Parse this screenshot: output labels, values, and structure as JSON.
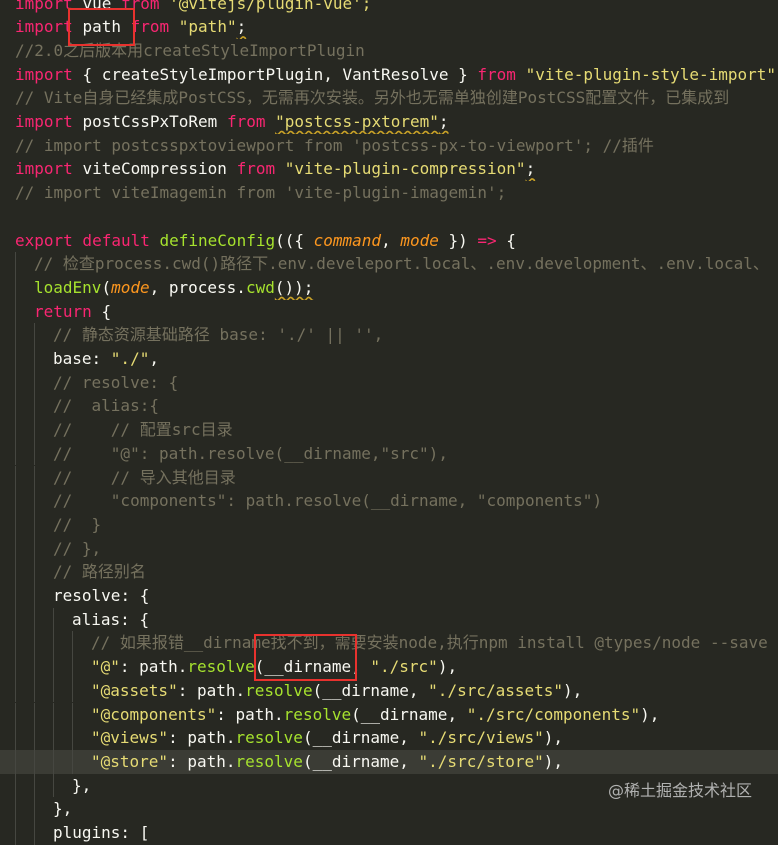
{
  "colors": {
    "background": "#272822",
    "keyword": "#f92672",
    "function": "#a6e22e",
    "string": "#e6db74",
    "comment": "#75715e",
    "param": "#fd971f",
    "text": "#f8f8f2",
    "annotation": "#e8322e"
  },
  "lines": [
    {
      "indent": 0,
      "tokens": [
        {
          "t": "import ",
          "c": "kw"
        },
        {
          "t": "vue ",
          "c": "tx"
        },
        {
          "t": "from ",
          "c": "kw"
        },
        {
          "t": "'@vitejs/plugin-vue';",
          "c": "st"
        }
      ]
    },
    {
      "indent": 0,
      "tokens": [
        {
          "t": "import ",
          "c": "kw"
        },
        {
          "t": "path ",
          "c": "tx"
        },
        {
          "t": "from ",
          "c": "kw"
        },
        {
          "t": "\"path\"",
          "c": "st"
        },
        {
          "t": ";",
          "c": "tx"
        }
      ]
    },
    {
      "indent": 0,
      "tokens": [
        {
          "t": "//2.0之后版本用createStyleImportPlugin",
          "c": "cm"
        }
      ]
    },
    {
      "indent": 0,
      "tokens": [
        {
          "t": "import ",
          "c": "kw"
        },
        {
          "t": "{ createStyleImportPlugin, VantResolve } ",
          "c": "tx"
        },
        {
          "t": "from ",
          "c": "kw"
        },
        {
          "t": "\"vite-plugin-style-import\"",
          "c": "st"
        },
        {
          "t": ";",
          "c": "tx"
        }
      ]
    },
    {
      "indent": 0,
      "tokens": [
        {
          "t": "// Vite自身已经集成PostCSS，无需再次安装。另外也无需单独创建PostCSS配置文件，已集成到",
          "c": "cm"
        }
      ]
    },
    {
      "indent": 0,
      "tokens": [
        {
          "t": "import ",
          "c": "kw"
        },
        {
          "t": "postCssPxToRem ",
          "c": "tx"
        },
        {
          "t": "from ",
          "c": "kw"
        },
        {
          "t": "\"postcss-pxtorem\"",
          "c": "st"
        },
        {
          "t": ";",
          "c": "tx"
        }
      ]
    },
    {
      "indent": 0,
      "tokens": [
        {
          "t": "// import postcsspxtoviewport from 'postcss-px-to-viewport'; //插件",
          "c": "cm"
        }
      ]
    },
    {
      "indent": 0,
      "tokens": [
        {
          "t": "import ",
          "c": "kw"
        },
        {
          "t": "viteCompression ",
          "c": "tx"
        },
        {
          "t": "from ",
          "c": "kw"
        },
        {
          "t": "\"vite-plugin-compression\"",
          "c": "st"
        },
        {
          "t": ";",
          "c": "tx"
        }
      ]
    },
    {
      "indent": 0,
      "tokens": [
        {
          "t": "// import viteImagemin from 'vite-plugin-imagemin';",
          "c": "cm"
        }
      ]
    },
    {
      "indent": 0,
      "tokens": []
    },
    {
      "indent": 0,
      "tokens": [
        {
          "t": "export default ",
          "c": "kw"
        },
        {
          "t": "defineConfig",
          "c": "fn"
        },
        {
          "t": "(({ ",
          "c": "tx"
        },
        {
          "t": "command",
          "c": "pa"
        },
        {
          "t": ", ",
          "c": "tx"
        },
        {
          "t": "mode",
          "c": "pa"
        },
        {
          "t": " }) ",
          "c": "tx"
        },
        {
          "t": "=>",
          "c": "kw"
        },
        {
          "t": " {",
          "c": "tx"
        }
      ]
    },
    {
      "indent": 1,
      "tokens": [
        {
          "t": "// 检查process.cwd()路径下.env.develeport.local、.env.development、.env.local、",
          "c": "cm"
        }
      ]
    },
    {
      "indent": 1,
      "tokens": [
        {
          "t": "loadEnv",
          "c": "fn"
        },
        {
          "t": "(",
          "c": "tx"
        },
        {
          "t": "mode",
          "c": "pa"
        },
        {
          "t": ", process.",
          "c": "tx"
        },
        {
          "t": "cwd",
          "c": "fn"
        },
        {
          "t": "());",
          "c": "tx"
        }
      ]
    },
    {
      "indent": 1,
      "tokens": [
        {
          "t": "return ",
          "c": "kw"
        },
        {
          "t": "{",
          "c": "tx"
        }
      ]
    },
    {
      "indent": 2,
      "tokens": [
        {
          "t": "// 静态资源基础路径 base: './' || '',",
          "c": "cm"
        }
      ]
    },
    {
      "indent": 2,
      "tokens": [
        {
          "t": "base",
          "c": "tx"
        },
        {
          "t": ": ",
          "c": "tx"
        },
        {
          "t": "\"./\"",
          "c": "st"
        },
        {
          "t": ",",
          "c": "tx"
        }
      ]
    },
    {
      "indent": 2,
      "tokens": [
        {
          "t": "// resolve: {",
          "c": "cm"
        }
      ]
    },
    {
      "indent": 2,
      "tokens": [
        {
          "t": "//  alias:{",
          "c": "cm"
        }
      ]
    },
    {
      "indent": 2,
      "tokens": [
        {
          "t": "//    // 配置src目录",
          "c": "cm"
        }
      ]
    },
    {
      "indent": 2,
      "tokens": [
        {
          "t": "//    \"@\": path.resolve(__dirname,\"src\"),",
          "c": "cm"
        }
      ]
    },
    {
      "indent": 2,
      "tokens": [
        {
          "t": "//    // 导入其他目录",
          "c": "cm"
        }
      ]
    },
    {
      "indent": 2,
      "tokens": [
        {
          "t": "//    \"components\": path.resolve(__dirname, \"components\")",
          "c": "cm"
        }
      ]
    },
    {
      "indent": 2,
      "tokens": [
        {
          "t": "//  }",
          "c": "cm"
        }
      ]
    },
    {
      "indent": 2,
      "tokens": [
        {
          "t": "// },",
          "c": "cm"
        }
      ]
    },
    {
      "indent": 2,
      "tokens": [
        {
          "t": "// 路径别名",
          "c": "cm"
        }
      ]
    },
    {
      "indent": 2,
      "tokens": [
        {
          "t": "resolve",
          "c": "tx"
        },
        {
          "t": ": {",
          "c": "tx"
        }
      ]
    },
    {
      "indent": 3,
      "tokens": [
        {
          "t": "alias",
          "c": "tx"
        },
        {
          "t": ": {",
          "c": "tx"
        }
      ]
    },
    {
      "indent": 4,
      "tokens": [
        {
          "t": "// 如果报错__dirname找不到，需要安装node,执行npm install @types/node --save",
          "c": "cm"
        }
      ]
    },
    {
      "indent": 4,
      "tokens": [
        {
          "t": "\"@\"",
          "c": "st"
        },
        {
          "t": ": path.",
          "c": "tx"
        },
        {
          "t": "resolve",
          "c": "fn"
        },
        {
          "t": "(__dirname, ",
          "c": "tx"
        },
        {
          "t": "\"./src\"",
          "c": "st"
        },
        {
          "t": "),",
          "c": "tx"
        }
      ]
    },
    {
      "indent": 4,
      "tokens": [
        {
          "t": "\"@assets\"",
          "c": "st"
        },
        {
          "t": ": path.",
          "c": "tx"
        },
        {
          "t": "resolve",
          "c": "fn"
        },
        {
          "t": "(__dirname, ",
          "c": "tx"
        },
        {
          "t": "\"./src/assets\"",
          "c": "st"
        },
        {
          "t": "),",
          "c": "tx"
        }
      ]
    },
    {
      "indent": 4,
      "tokens": [
        {
          "t": "\"@components\"",
          "c": "st"
        },
        {
          "t": ": path.",
          "c": "tx"
        },
        {
          "t": "resolve",
          "c": "fn"
        },
        {
          "t": "(__dirname, ",
          "c": "tx"
        },
        {
          "t": "\"./src/components\"",
          "c": "st"
        },
        {
          "t": "),",
          "c": "tx"
        }
      ]
    },
    {
      "indent": 4,
      "tokens": [
        {
          "t": "\"@views\"",
          "c": "st"
        },
        {
          "t": ": path.",
          "c": "tx"
        },
        {
          "t": "resolve",
          "c": "fn"
        },
        {
          "t": "(__dirname, ",
          "c": "tx"
        },
        {
          "t": "\"./src/views\"",
          "c": "st"
        },
        {
          "t": "),",
          "c": "tx"
        }
      ]
    },
    {
      "indent": 4,
      "tokens": [
        {
          "t": "\"@store\"",
          "c": "st"
        },
        {
          "t": ": path.",
          "c": "tx"
        },
        {
          "t": "resolve",
          "c": "fn"
        },
        {
          "t": "(__dirname, ",
          "c": "tx"
        },
        {
          "t": "\"./src/store\"",
          "c": "st"
        },
        {
          "t": "),",
          "c": "tx"
        }
      ]
    },
    {
      "indent": 3,
      "tokens": [
        {
          "t": "},",
          "c": "tx"
        }
      ]
    },
    {
      "indent": 2,
      "tokens": [
        {
          "t": "},",
          "c": "tx"
        }
      ]
    },
    {
      "indent": 2,
      "tokens": [
        {
          "t": "plugins: [",
          "c": "tx"
        }
      ]
    }
  ],
  "watermark": "@稀土掘金技术社区"
}
